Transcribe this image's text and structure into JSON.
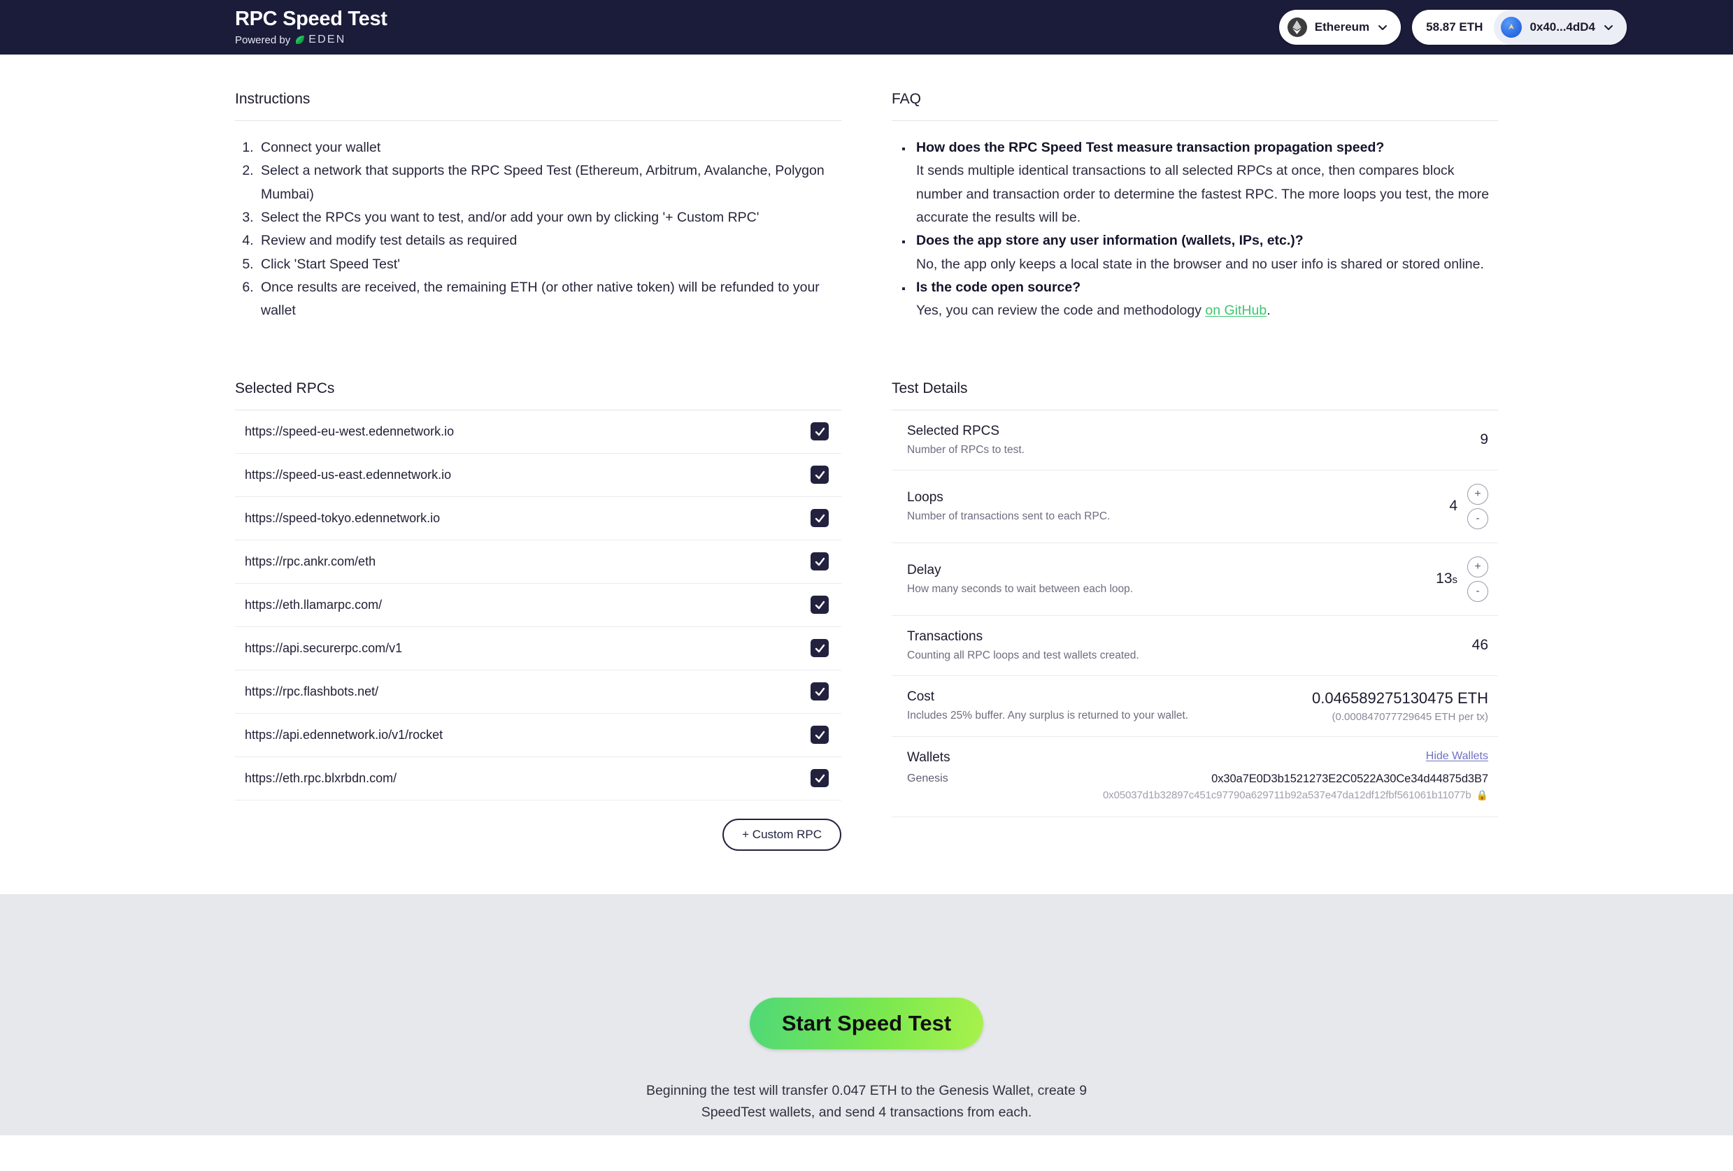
{
  "header": {
    "brand_title": "RPC Speed Test",
    "powered_by": "Powered by",
    "eden_wordmark": "EDEN",
    "network": {
      "label": "Ethereum",
      "icon": "ethereum-icon",
      "chevron": "chevron-down-icon"
    },
    "wallet": {
      "balance": "58.87 ETH",
      "address": "0x40...4dD4",
      "avatar": "wallet-avatar-icon",
      "chevron": "chevron-down-icon"
    }
  },
  "instructions": {
    "title": "Instructions",
    "steps": [
      "Connect your wallet",
      "Select a network that supports the RPC Speed Test (Ethereum, Arbitrum, Avalanche, Polygon Mumbai)",
      "Select the RPCs you want to test, and/or add your own by clicking '+ Custom RPC'",
      "Review and modify test details as required",
      "Click 'Start Speed Test'",
      "Once results are received, the remaining ETH (or other native token) will be refunded to your wallet"
    ]
  },
  "faq": {
    "title": "FAQ",
    "items": [
      {
        "question": "How does the RPC Speed Test measure transaction propagation speed?",
        "answer": "It sends multiple identical transactions to all selected RPCs at once, then compares block number and transaction order to determine the fastest RPC. The more loops you test, the more accurate the results will be."
      },
      {
        "question": "Does the app store any user information (wallets, IPs, etc.)?",
        "answer": "No, the app only keeps a local state in the browser and no user info is shared or stored online."
      },
      {
        "question": "Is the code open source?",
        "answer_prefix": "Yes, you can review the code and methodology ",
        "link_text": "on GitHub",
        "answer_suffix": "."
      }
    ]
  },
  "selected_rpcs": {
    "title": "Selected RPCs",
    "add_button": "+ Custom RPC",
    "rows": [
      {
        "url": "https://speed-eu-west.edennetwork.io",
        "checked": true
      },
      {
        "url": "https://speed-us-east.edennetwork.io",
        "checked": true
      },
      {
        "url": "https://speed-tokyo.edennetwork.io",
        "checked": true
      },
      {
        "url": "https://rpc.ankr.com/eth",
        "checked": true
      },
      {
        "url": "https://eth.llamarpc.com/",
        "checked": true
      },
      {
        "url": "https://api.securerpc.com/v1",
        "checked": true
      },
      {
        "url": "https://rpc.flashbots.net/",
        "checked": true
      },
      {
        "url": "https://api.edennetwork.io/v1/rocket",
        "checked": true
      },
      {
        "url": "https://eth.rpc.blxrbdn.com/",
        "checked": true
      }
    ]
  },
  "test_details": {
    "title": "Test Details",
    "selected_rpcs": {
      "label": "Selected RPCS",
      "desc": "Number of RPCs to test.",
      "value": "9"
    },
    "loops": {
      "label": "Loops",
      "desc": "Number of transactions sent to each RPC.",
      "value": "4",
      "increment": "+",
      "decrement": "-"
    },
    "delay": {
      "label": "Delay",
      "desc": "How many seconds to wait between each loop.",
      "value": "13",
      "unit": "s",
      "increment": "+",
      "decrement": "-"
    },
    "transactions": {
      "label": "Transactions",
      "desc": "Counting all RPC loops and test wallets created.",
      "value": "46"
    },
    "cost": {
      "label": "Cost",
      "desc": "Includes 25% buffer. Any surplus is returned to your wallet.",
      "value": "0.046589275130475 ETH",
      "per_tx": "(0.000847077729645 ETH per tx)"
    },
    "wallets": {
      "label": "Wallets",
      "toggle": "Hide Wallets",
      "genesis_label": "Genesis",
      "genesis_address": "0x30a7E0D3b1521273E2C0522A30Ce34d44875d3B7",
      "genesis_private_key": "0x05037d1b32897c451c97790a629711b92a537e47da12df12fbf561061b11077b",
      "lock_icon": "lock-icon"
    }
  },
  "cta": {
    "button_label": "Start Speed Test",
    "note_line1": "Beginning the test will transfer 0.047 ETH to the Genesis Wallet, create 9",
    "note_line2": "SpeedTest wallets, and send 4 transactions from each."
  },
  "colors": {
    "navbar_bg": "#1b1b3a",
    "checkbox_bg": "#22223f",
    "link_green": "#39c76d",
    "link_purple": "#6f6fc4",
    "cta_gradient_start": "#4fd878",
    "cta_gradient_end": "#a9f24c",
    "cta_band_bg": "#e6e8ec"
  }
}
